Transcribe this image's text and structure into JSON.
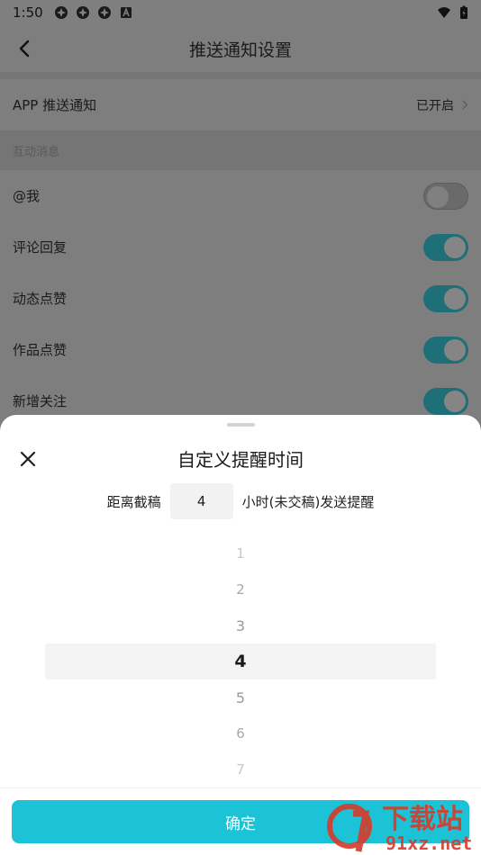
{
  "status_bar": {
    "time": "1:50"
  },
  "settings_page": {
    "title": "推送通知设置",
    "app_push": {
      "label": "APP 推送通知",
      "value": "已开启"
    },
    "section_label": "互动消息",
    "items": [
      {
        "label": "@我",
        "enabled": false
      },
      {
        "label": "评论回复",
        "enabled": true
      },
      {
        "label": "动态点赞",
        "enabled": true
      },
      {
        "label": "作品点赞",
        "enabled": true
      },
      {
        "label": "新增关注",
        "enabled": true
      }
    ]
  },
  "sheet": {
    "title": "自定义提醒时间",
    "prefix": "距离截稿",
    "hours_value": "4",
    "suffix": "小时(未交稿)发送提醒",
    "picker_options": [
      "1",
      "2",
      "3",
      "4",
      "5",
      "6",
      "7"
    ],
    "selected_index": 3,
    "confirm_label": "确定"
  },
  "watermark": {
    "brand": "下载站",
    "site": "91xz.net"
  },
  "colors": {
    "accent": "#1cc3d6",
    "toggle_on": "#1f6f78"
  }
}
